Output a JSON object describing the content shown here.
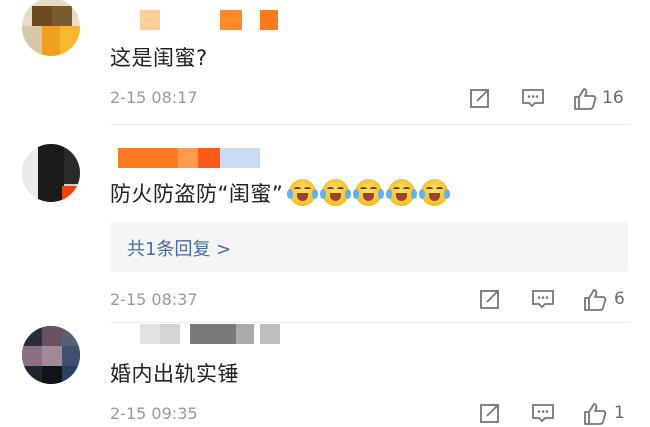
{
  "colors": {
    "link": "#4c6b9a",
    "meta": "#9a9a9a",
    "text": "#222222"
  },
  "comments": [
    {
      "text": "这是闺蜜?",
      "time": "2-15 08:17",
      "likes": "16",
      "icons": [
        "share-icon",
        "comment-icon",
        "thumbs-up-icon"
      ]
    },
    {
      "text": "防火防盗防“闺蜜”",
      "emoji_count": 5,
      "emoji_name": "laugh-cry-emoji",
      "reply_link": "共1条回复 >",
      "time": "2-15 08:37",
      "likes": "6",
      "icons": [
        "share-icon",
        "comment-icon",
        "thumbs-up-icon"
      ]
    },
    {
      "text": "婚内出轨实锤",
      "time": "2-15 09:35",
      "likes": "1",
      "icons": [
        "share-icon",
        "comment-icon",
        "thumbs-up-icon"
      ]
    }
  ]
}
